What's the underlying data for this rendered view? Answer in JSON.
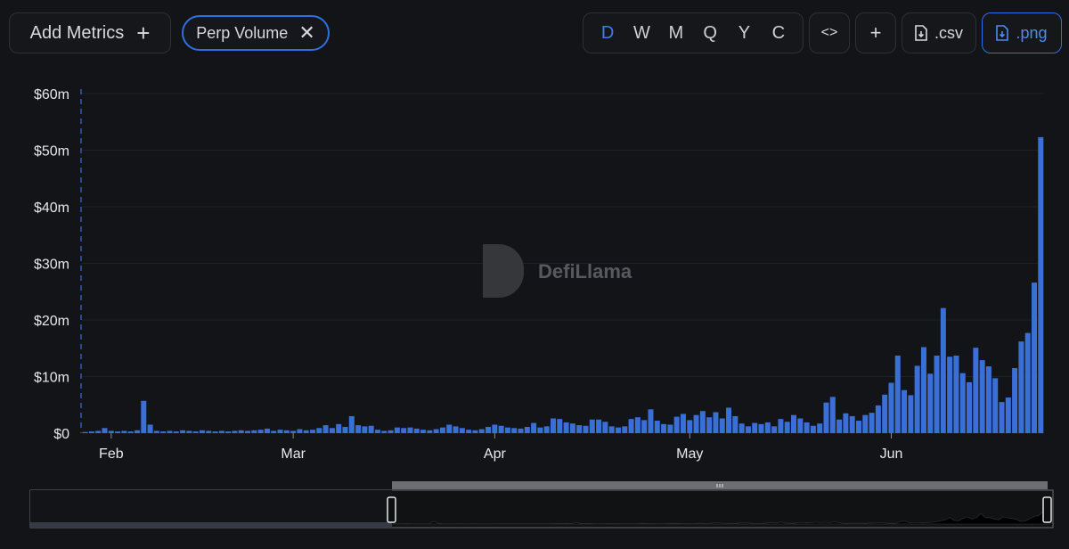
{
  "toolbar": {
    "add_metrics_label": "Add Metrics",
    "add_icon": "plus-icon",
    "metric_chip_label": "Perp Volume",
    "remove_icon": "close-icon",
    "periods": [
      "D",
      "W",
      "M",
      "Q",
      "Y",
      "C"
    ],
    "active_period": "D",
    "embed_label": "<>",
    "add_label": "+",
    "csv_label": ".csv",
    "png_label": ".png",
    "accent_color": "#2f6fe4"
  },
  "watermark": {
    "text": "DefiLlama"
  },
  "chart_data": {
    "type": "bar",
    "title": "",
    "xlabel": "",
    "ylabel": "",
    "series_name": "Perp Volume",
    "color": "#3a6fd8",
    "ylim": [
      0,
      60
    ],
    "y_unit": "$m",
    "yticks": [
      "$0",
      "$10m",
      "$20m",
      "$30m",
      "$40m",
      "$50m",
      "$60m"
    ],
    "xticks": [
      {
        "label": "Feb",
        "date": "2025-02-01"
      },
      {
        "label": "Mar",
        "date": "2025-03-01"
      },
      {
        "label": "Apr",
        "date": "2025-04-01"
      },
      {
        "label": "May",
        "date": "2025-05-01"
      },
      {
        "label": "Jun",
        "date": "2025-06-01"
      }
    ],
    "start_date": "2025-01-28",
    "values": [
      0.2,
      0.3,
      0.4,
      0.9,
      0.4,
      0.3,
      0.4,
      0.3,
      0.5,
      5.7,
      1.5,
      0.4,
      0.3,
      0.4,
      0.3,
      0.5,
      0.4,
      0.3,
      0.5,
      0.4,
      0.3,
      0.4,
      0.3,
      0.4,
      0.5,
      0.4,
      0.5,
      0.6,
      0.8,
      0.4,
      0.6,
      0.5,
      0.4,
      0.7,
      0.5,
      0.6,
      0.9,
      1.4,
      0.9,
      1.6,
      1.1,
      3.0,
      1.4,
      1.2,
      1.3,
      0.6,
      0.4,
      0.5,
      1.0,
      0.9,
      1.0,
      0.8,
      0.6,
      0.5,
      0.7,
      1.0,
      1.5,
      1.2,
      0.9,
      0.6,
      0.5,
      0.7,
      1.1,
      1.5,
      1.3,
      1.0,
      0.9,
      0.8,
      1.1,
      1.8,
      1.0,
      1.2,
      2.6,
      2.5,
      1.9,
      1.7,
      1.4,
      1.3,
      2.4,
      2.4,
      2.0,
      1.2,
      1.0,
      1.2,
      2.5,
      2.8,
      2.3,
      4.2,
      2.2,
      1.6,
      1.5,
      2.9,
      3.4,
      2.3,
      3.2,
      3.9,
      2.8,
      3.7,
      2.6,
      4.5,
      3.0,
      1.7,
      1.2,
      1.8,
      1.6,
      1.9,
      1.2,
      2.5,
      2.0,
      3.2,
      2.6,
      1.9,
      1.3,
      1.7,
      5.4,
      6.4,
      2.4,
      3.5,
      3.0,
      2.2,
      3.2,
      3.6,
      4.9,
      6.8,
      8.9,
      13.7,
      7.6,
      6.7,
      11.9,
      15.2,
      10.5,
      13.7,
      22.1,
      13.5,
      13.7,
      10.6,
      9.0,
      15.1,
      12.9,
      11.8,
      9.7,
      5.5,
      6.3,
      11.5,
      16.2,
      17.7,
      26.6,
      52.3
    ]
  }
}
